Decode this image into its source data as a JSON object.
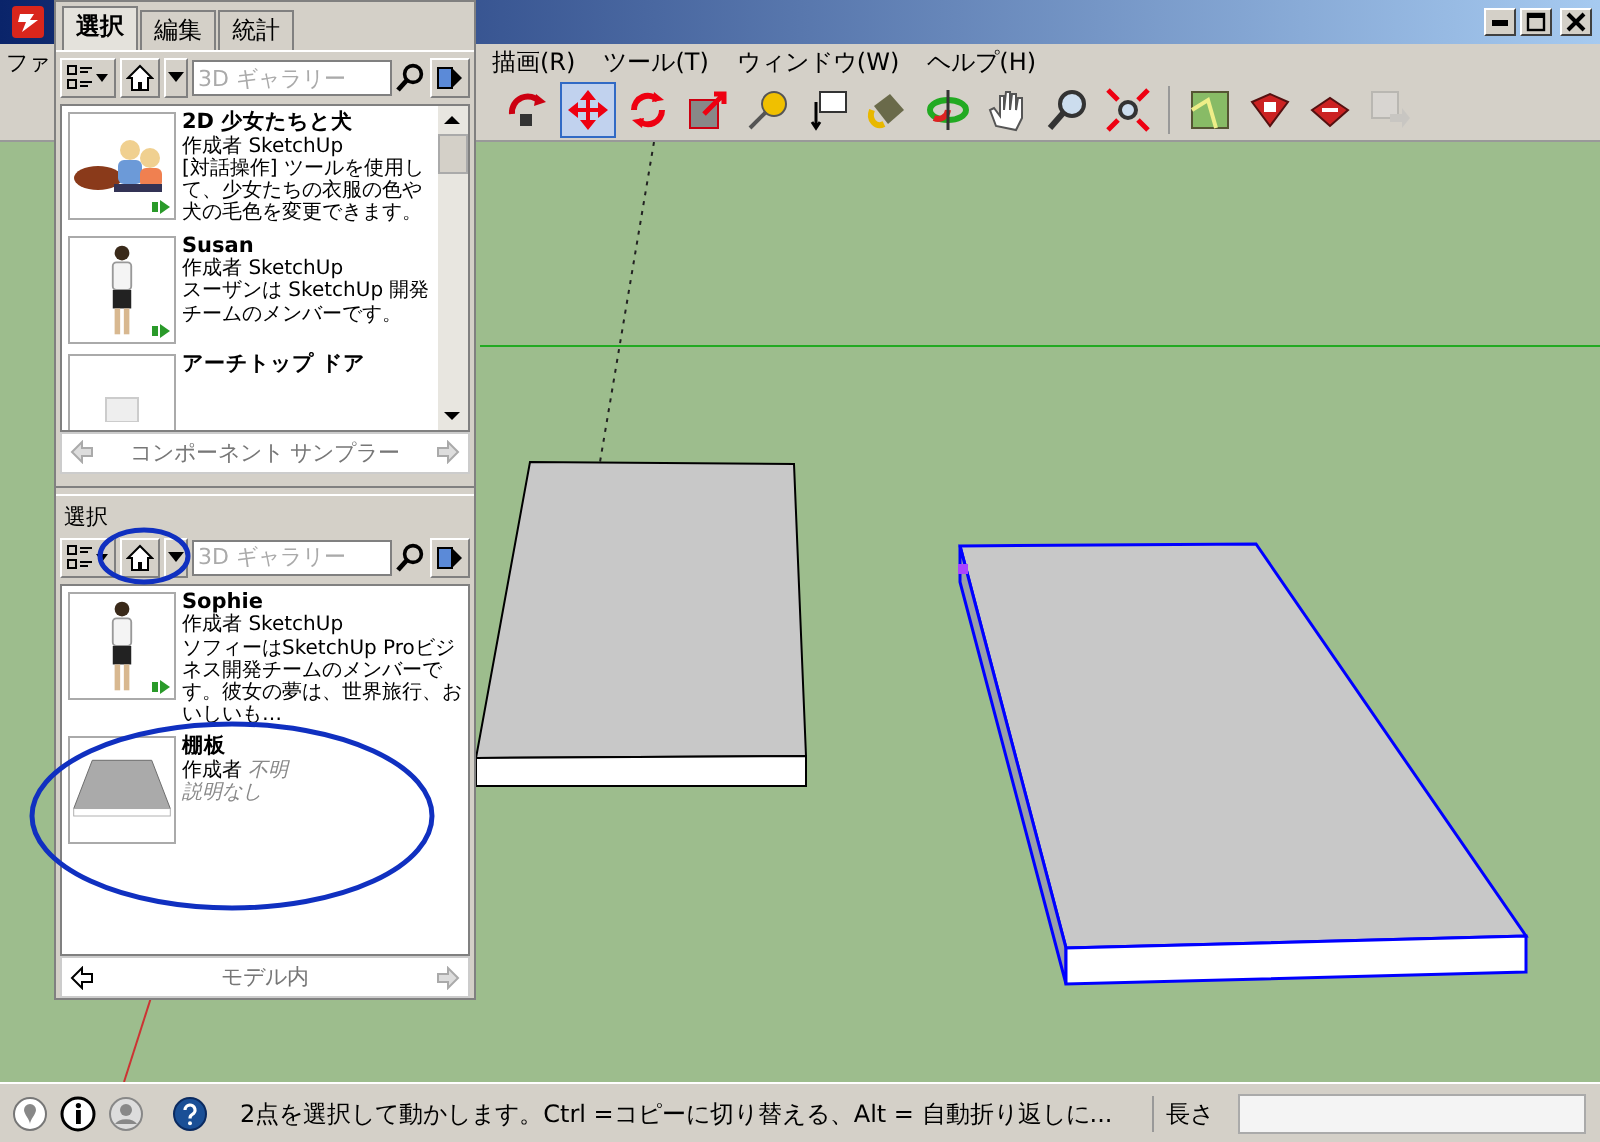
{
  "menu_bar": {
    "items": [
      {
        "label": "ファ"
      },
      {
        "label": "描画(R)"
      },
      {
        "label": "ツール(T)"
      },
      {
        "label": "ウィンドウ(W)"
      },
      {
        "label": "ヘルプ(H)"
      }
    ]
  },
  "toolbar": {
    "groups": [
      {
        "tools": [
          {
            "kind": "follow",
            "selected": false,
            "disabled": false
          },
          {
            "kind": "move",
            "selected": true,
            "disabled": false
          },
          {
            "kind": "rotate",
            "selected": false,
            "disabled": false
          },
          {
            "kind": "scale",
            "selected": false,
            "disabled": false
          },
          {
            "kind": "tape",
            "selected": false,
            "disabled": false
          },
          {
            "kind": "text",
            "selected": false,
            "disabled": false
          },
          {
            "kind": "paint",
            "selected": false,
            "disabled": false
          },
          {
            "kind": "orbit",
            "selected": false,
            "disabled": false
          },
          {
            "kind": "pan",
            "selected": false,
            "disabled": false
          },
          {
            "kind": "zoom",
            "selected": false,
            "disabled": false
          },
          {
            "kind": "extents",
            "selected": false,
            "disabled": false
          }
        ]
      },
      {
        "tools": [
          {
            "kind": "map",
            "selected": false,
            "disabled": false
          },
          {
            "kind": "warehouse",
            "selected": false,
            "disabled": false
          },
          {
            "kind": "share",
            "selected": false,
            "disabled": false
          },
          {
            "kind": "send",
            "selected": false,
            "disabled": true
          }
        ]
      }
    ]
  },
  "components_panel": {
    "tabs": [
      {
        "label": "選択",
        "selected": true
      },
      {
        "label": "編集",
        "selected": false
      },
      {
        "label": "統計",
        "selected": false
      }
    ],
    "browsers": [
      {
        "search": {
          "placeholder": "3D ギャラリー"
        },
        "items": [
          {
            "kind": "figures",
            "title": "2D 少女たちと犬",
            "author_label": "作成者",
            "author": "SketchUp",
            "author_missing": false,
            "description": "[対話操作] ツールを使用して、少女たちの衣服の色や犬の毛色を変更できます。",
            "description_missing": false,
            "dynamic": true
          },
          {
            "kind": "person",
            "title": "Susan",
            "author_label": "作成者",
            "author": "SketchUp",
            "author_missing": false,
            "description": "スーザンは SketchUp 開発チームのメンバーです。",
            "description_missing": false,
            "dynamic": true
          },
          {
            "kind": "door",
            "title": "アーチトップ ドア"
          }
        ],
        "scrollbar": true,
        "collection": "コンポーネント サンプラー"
      },
      {
        "section_label": "選択",
        "search": {
          "placeholder": "3D ギャラリー"
        },
        "items": [
          {
            "kind": "person",
            "title": "Sophie",
            "author_label": "作成者",
            "author": "SketchUp",
            "author_missing": false,
            "description": "ソフィーはSketchUp Proビジネス開発チームのメンバーです。彼女の夢は、世界旅行、おいしいも…",
            "description_missing": false,
            "dynamic": true
          },
          {
            "kind": "slab",
            "title": "棚板",
            "author_label": "作成者",
            "author": "不明",
            "author_missing": true,
            "description": "説明なし",
            "description_missing": true,
            "dynamic": false
          }
        ],
        "scrollbar": false,
        "collection": "モデル内"
      }
    ]
  },
  "status_bar": {
    "message": "2点を選択して動かします。Ctrl =コピーに切り替える、Alt = 自動折り返しに...",
    "measurement_label": "長さ"
  }
}
